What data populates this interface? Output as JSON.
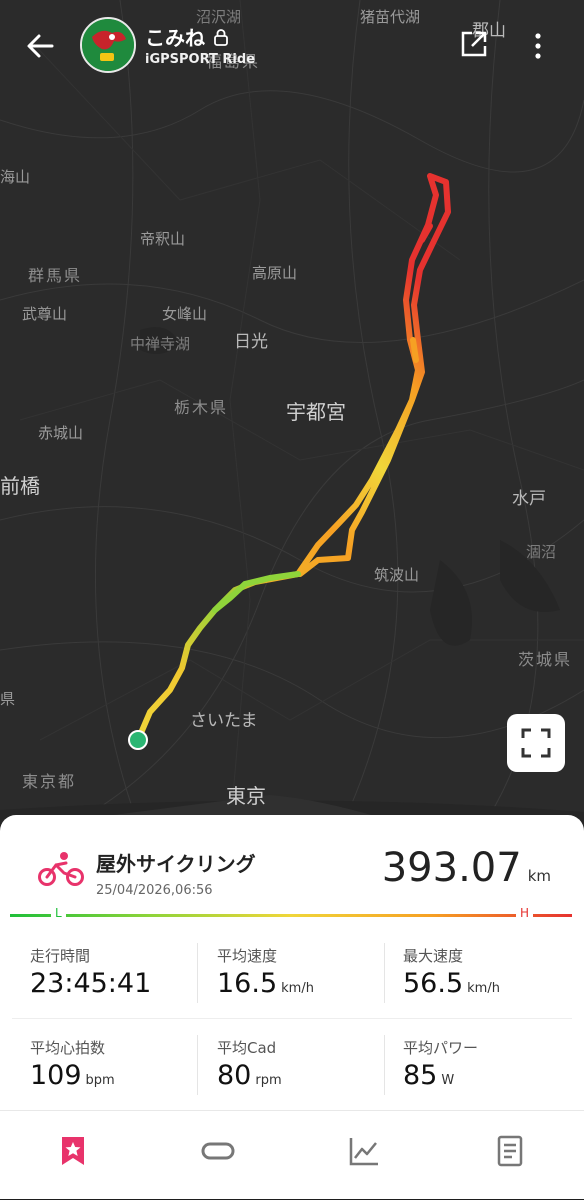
{
  "header": {
    "user_name": "こみね",
    "user_subtitle": "iGPSPORT Ride",
    "icons": [
      "back-arrow-icon",
      "lock-icon",
      "share-icon",
      "more-vertical-icon"
    ]
  },
  "map": {
    "place_names": {
      "numazawa_ko": "沼沢湖",
      "inawashiro": "猪苗代湖",
      "koriyama": "郡山",
      "fukushima_ken": "福島県",
      "umiyama": "海山",
      "teishakusan": "帝釈山",
      "gunma_ken": "群馬県",
      "takaharayama": "高原山",
      "busonsan": "武尊山",
      "nyohosan": "女峰山",
      "chuzenjiko": "中禅寺湖",
      "nikko": "日光",
      "tochigi_ken": "栃木県",
      "utsunomiya": "宇都宮",
      "akagisan": "赤城山",
      "maebashi": "前橋",
      "mito": "水戸",
      "hinuma": "涸沼",
      "tsukubasan": "筑波山",
      "ibaraki_ken": "茨城県",
      "saitama": "さいたま",
      "tokyo_to": "東京都",
      "tokyo": "東京",
      "edge_ken": "県"
    },
    "fullscreen_icon": "fullscreen-icon"
  },
  "activity": {
    "type_icon": "cycling-icon",
    "title": "屋外サイクリング",
    "date": "25/04/2026,06:56",
    "distance_value": "393.07",
    "distance_unit": "km",
    "gradient_low": "L",
    "gradient_high": "H",
    "stats": [
      {
        "label": "走行時間",
        "value": "23:45:41",
        "unit": ""
      },
      {
        "label": "平均速度",
        "value": "16.5",
        "unit": "km/h"
      },
      {
        "label": "最大速度",
        "value": "56.5",
        "unit": "km/h"
      },
      {
        "label": "平均心拍数",
        "value": "109",
        "unit": "bpm"
      },
      {
        "label": "平均Cad",
        "value": "80",
        "unit": "rpm"
      },
      {
        "label": "平均パワー",
        "value": "85",
        "unit": "W"
      }
    ]
  },
  "bottom_nav": {
    "items": [
      "star-badge-icon",
      "route-icon",
      "chart-icon",
      "document-icon"
    ],
    "active_color": "#e8336b"
  },
  "colors": {
    "accent": "#e8336b",
    "route_low": "#1fbf3a",
    "route_mid": "#f0d63a",
    "route_high": "#e6322f"
  }
}
